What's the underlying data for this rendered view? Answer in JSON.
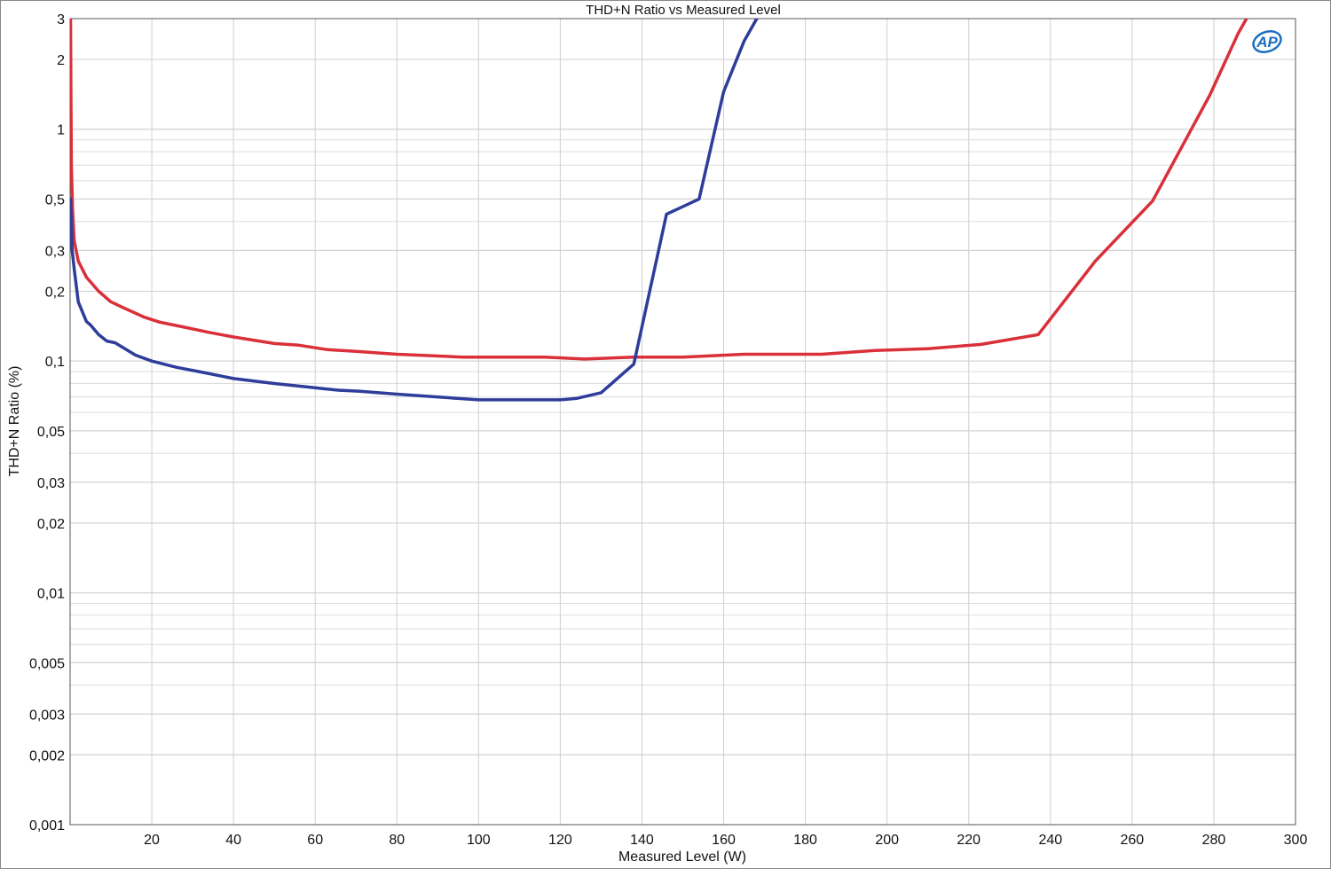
{
  "chart_data": {
    "type": "line",
    "title": "THD+N Ratio vs Measured Level",
    "xlabel": "Measured Level (W)",
    "ylabel": "THD+N Ratio (%)",
    "xlim": [
      0,
      300
    ],
    "ylim": [
      0.001,
      3
    ],
    "yscale": "log",
    "grid": true,
    "x_ticks": [
      20,
      40,
      60,
      80,
      100,
      120,
      140,
      160,
      180,
      200,
      220,
      240,
      260,
      280,
      300
    ],
    "y_ticks": [
      {
        "value": 3,
        "label": "3"
      },
      {
        "value": 2,
        "label": "2"
      },
      {
        "value": 1,
        "label": "1"
      },
      {
        "value": 0.5,
        "label": "0,5"
      },
      {
        "value": 0.3,
        "label": "0,3"
      },
      {
        "value": 0.2,
        "label": "0,2"
      },
      {
        "value": 0.1,
        "label": "0,1"
      },
      {
        "value": 0.05,
        "label": "0,05"
      },
      {
        "value": 0.03,
        "label": "0,03"
      },
      {
        "value": 0.02,
        "label": "0,02"
      },
      {
        "value": 0.01,
        "label": "0,01"
      },
      {
        "value": 0.005,
        "label": "0,005"
      },
      {
        "value": 0.003,
        "label": "0,003"
      },
      {
        "value": 0.002,
        "label": "0,002"
      },
      {
        "value": 0.001,
        "label": "0,001"
      }
    ],
    "logo_text": "AP",
    "colors": {
      "series_1": "#d9303a",
      "series_2": "#2e3d9a",
      "grid": "#dcdcdc",
      "logo": "#1a6fc0"
    },
    "series": [
      {
        "color": "#d9303a",
        "x": [
          0.1,
          0.3,
          0.6,
          1,
          2,
          4,
          7,
          10,
          13,
          18,
          22,
          28,
          34,
          40,
          50,
          56,
          63,
          70,
          80,
          96,
          116,
          126,
          138,
          150,
          165,
          184,
          197,
          210,
          223,
          237,
          251,
          265,
          279,
          286,
          288
        ],
        "y": [
          3,
          0.7,
          0.45,
          0.33,
          0.27,
          0.23,
          0.2,
          0.18,
          0.17,
          0.155,
          0.147,
          0.14,
          0.133,
          0.127,
          0.119,
          0.117,
          0.112,
          0.11,
          0.107,
          0.104,
          0.104,
          0.102,
          0.104,
          0.104,
          0.107,
          0.107,
          0.111,
          0.113,
          0.118,
          0.13,
          0.27,
          0.49,
          1.4,
          2.6,
          3
        ]
      },
      {
        "color": "#2e3d9a",
        "x": [
          0.1,
          0.5,
          1,
          2,
          4,
          5,
          7,
          9,
          11,
          16,
          20,
          26,
          33,
          40,
          50,
          56,
          65,
          71,
          80,
          100,
          120,
          124,
          130,
          138,
          146,
          154,
          160,
          165,
          169
        ],
        "y": [
          0.5,
          0.3,
          0.25,
          0.18,
          0.148,
          0.143,
          0.13,
          0.122,
          0.12,
          0.106,
          0.1,
          0.094,
          0.089,
          0.084,
          0.08,
          0.078,
          0.075,
          0.074,
          0.072,
          0.068,
          0.068,
          0.069,
          0.073,
          0.097,
          0.43,
          0.5,
          1.45,
          2.4,
          3.2
        ]
      }
    ]
  }
}
